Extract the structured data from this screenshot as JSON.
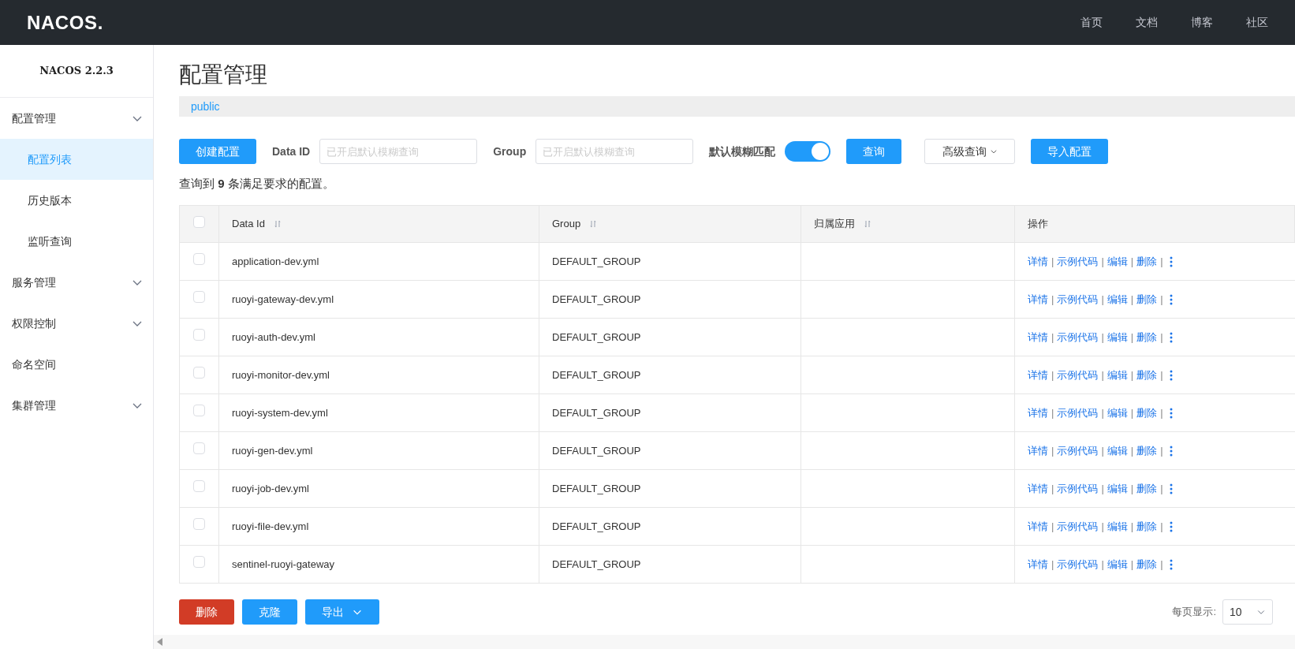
{
  "topbar": {
    "logo": "NACOS.",
    "nav": [
      "首页",
      "文档",
      "博客",
      "社区"
    ]
  },
  "sidebar": {
    "title": "NACOS 2.2.3",
    "items": [
      {
        "label": "配置管理",
        "expandable": true,
        "children": [
          {
            "label": "配置列表",
            "selected": true
          },
          {
            "label": "历史版本",
            "selected": false
          },
          {
            "label": "监听查询",
            "selected": false
          }
        ]
      },
      {
        "label": "服务管理",
        "expandable": true
      },
      {
        "label": "权限控制",
        "expandable": true
      },
      {
        "label": "命名空间",
        "expandable": false
      },
      {
        "label": "集群管理",
        "expandable": true
      }
    ]
  },
  "page": {
    "title": "配置管理",
    "namespace": "public"
  },
  "toolbar": {
    "create_button": "创建配置",
    "data_id": {
      "label": "Data ID",
      "placeholder": "已开启默认模糊查询"
    },
    "group": {
      "label": "Group",
      "placeholder": "已开启默认模糊查询"
    },
    "fuzzy": {
      "label": "默认模糊匹配",
      "on": true
    },
    "query_button": "查询",
    "advanced_button": "高级查询",
    "import_button": "导入配置"
  },
  "summary": "查询到 **9** 条满足要求的配置。",
  "table": {
    "header_checked": false,
    "columns": [
      {
        "label": "Data Id",
        "sortable": true
      },
      {
        "label": "Group",
        "sortable": true
      },
      {
        "label": "归属应用",
        "sortable": true
      },
      {
        "label": "操作",
        "sortable": false
      }
    ],
    "rows": [
      {
        "checked": false,
        "data_id": "application-dev.yml",
        "group": "DEFAULT_GROUP",
        "actions": [
          "详情",
          "示例代码",
          "编辑",
          "删除"
        ],
        "separator": "|"
      },
      {
        "checked": false,
        "data_id": "ruoyi-gateway-dev.yml",
        "group": "DEFAULT_GROUP",
        "actions": [
          "详情",
          "示例代码",
          "编辑",
          "删除"
        ],
        "separator": "|"
      },
      {
        "checked": false,
        "data_id": "ruoyi-auth-dev.yml",
        "group": "DEFAULT_GROUP",
        "actions": [
          "详情",
          "示例代码",
          "编辑",
          "删除"
        ],
        "separator": "|"
      },
      {
        "checked": false,
        "data_id": "ruoyi-monitor-dev.yml",
        "group": "DEFAULT_GROUP",
        "actions": [
          "详情",
          "示例代码",
          "编辑",
          "删除"
        ],
        "separator": "|"
      },
      {
        "checked": false,
        "data_id": "ruoyi-system-dev.yml",
        "group": "DEFAULT_GROUP",
        "actions": [
          "详情",
          "示例代码",
          "编辑",
          "删除"
        ],
        "separator": "|"
      },
      {
        "checked": false,
        "data_id": "ruoyi-gen-dev.yml",
        "group": "DEFAULT_GROUP",
        "actions": [
          "详情",
          "示例代码",
          "编辑",
          "删除"
        ],
        "separator": "|"
      },
      {
        "checked": false,
        "data_id": "ruoyi-job-dev.yml",
        "group": "DEFAULT_GROUP",
        "actions": [
          "详情",
          "示例代码",
          "编辑",
          "删除"
        ],
        "separator": "|"
      },
      {
        "checked": false,
        "data_id": "ruoyi-file-dev.yml",
        "group": "DEFAULT_GROUP",
        "actions": [
          "详情",
          "示例代码",
          "编辑",
          "删除"
        ],
        "separator": "|"
      },
      {
        "checked": false,
        "data_id": "sentinel-ruoyi-gateway",
        "group": "DEFAULT_GROUP",
        "actions": [
          "详情",
          "示例代码",
          "编辑",
          "删除"
        ],
        "separator": "|"
      }
    ]
  },
  "footer": {
    "delete_button": "删除",
    "clone_button": "克隆",
    "export_button": "导出",
    "page_size_label": "每页显示:",
    "page_size": "10"
  }
}
